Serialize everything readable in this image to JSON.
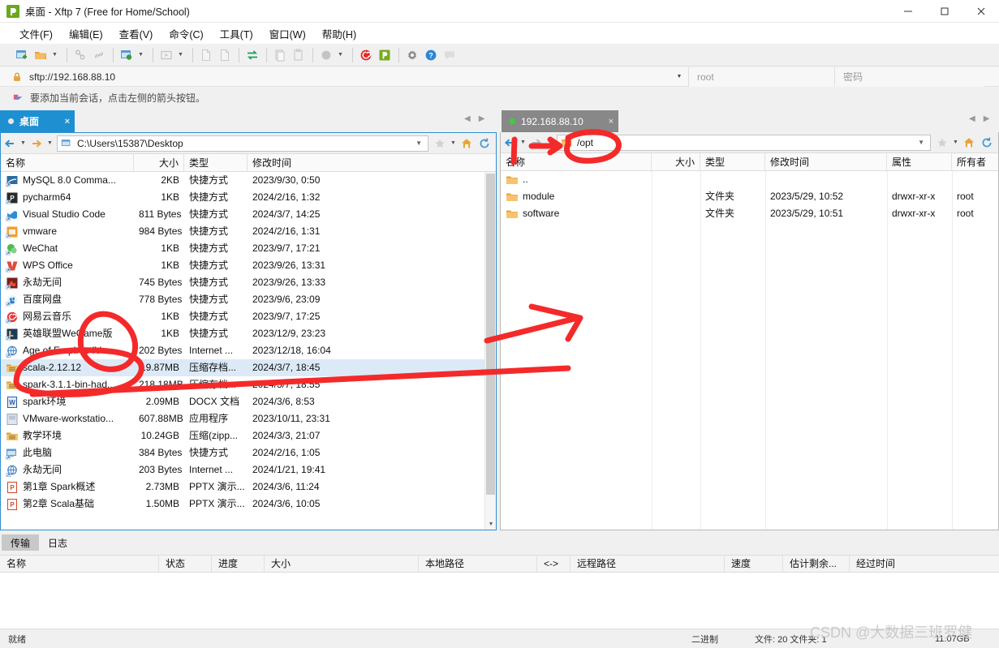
{
  "window": {
    "title": "桌面 - Xftp 7 (Free for Home/School)",
    "minimize": "—",
    "maximize": "☐",
    "close": "✕"
  },
  "menu": [
    {
      "label": "文件(F)"
    },
    {
      "label": "编辑(E)"
    },
    {
      "label": "查看(V)"
    },
    {
      "label": "命令(C)"
    },
    {
      "label": "工具(T)"
    },
    {
      "label": "窗口(W)"
    },
    {
      "label": "帮助(H)"
    }
  ],
  "toolbar": {
    "icons": [
      "new-session-icon",
      "open-folder-icon",
      "folder-dropdown-caret",
      "disconnect-icon",
      "link-icon",
      "sync-browse-icon",
      "sync-dropdown-caret",
      "transfer-start-icon",
      "transfer-dropdown-caret",
      "new-file-icon",
      "copy-file-icon",
      "swap-panes-icon",
      "copy-icon",
      "paste-icon",
      "record-icon",
      "record-dropdown-caret",
      "xshell-icon",
      "xftp-icon",
      "settings-gear-icon",
      "help-icon",
      "chat-icon"
    ]
  },
  "address": {
    "lock_icon": "lock-icon",
    "url": "sftp://192.168.88.10",
    "dropdown_caret": "chevron-down-icon",
    "username_placeholder": "root",
    "password_placeholder": "密码"
  },
  "hint": {
    "icon": "flag-icon",
    "text": "要添加当前会话，点击左侧的箭头按钮。"
  },
  "tabs": {
    "left": {
      "label": "桌面",
      "close": "×",
      "status_dot": "idle-dot-icon"
    },
    "right": {
      "label": "192.168.88.10",
      "close": "×",
      "status_dot": "connected-dot-icon"
    },
    "nav_prev": "◀",
    "nav_next": "▶"
  },
  "left_pane": {
    "path": "C:\\Users\\15387\\Desktop",
    "path_icon": "computer-folder-icon",
    "back_icon": "back-arrow-icon",
    "forward_icon": "forward-arrow-icon",
    "favorite_icon": "star-icon",
    "home_icon": "home-icon",
    "refresh_icon": "refresh-icon",
    "columns": [
      "名称",
      "大小",
      "类型",
      "修改时间"
    ],
    "rows": [
      {
        "name": "MySQL 8.0 Comma...",
        "size": "2KB",
        "type": "快捷方式",
        "mtime": "2023/9/30, 0:50",
        "icon": "shortcut-mysql-icon",
        "selected": false
      },
      {
        "name": "pycharm64",
        "size": "1KB",
        "type": "快捷方式",
        "mtime": "2024/2/16, 1:32",
        "icon": "shortcut-pycharm-icon",
        "selected": false
      },
      {
        "name": "Visual Studio Code",
        "size": "811 Bytes",
        "type": "快捷方式",
        "mtime": "2024/3/7, 14:25",
        "icon": "shortcut-vscode-icon",
        "selected": false
      },
      {
        "name": "vmware",
        "size": "984 Bytes",
        "type": "快捷方式",
        "mtime": "2024/2/16, 1:31",
        "icon": "shortcut-vmware-icon",
        "selected": false
      },
      {
        "name": "WeChat",
        "size": "1KB",
        "type": "快捷方式",
        "mtime": "2023/9/7, 17:21",
        "icon": "shortcut-wechat-icon",
        "selected": false
      },
      {
        "name": "WPS Office",
        "size": "1KB",
        "type": "快捷方式",
        "mtime": "2023/9/26, 13:31",
        "icon": "shortcut-wps-icon",
        "selected": false
      },
      {
        "name": "永劫无间",
        "size": "745 Bytes",
        "type": "快捷方式",
        "mtime": "2023/9/26, 13:33",
        "icon": "shortcut-game-icon",
        "selected": false
      },
      {
        "name": "百度网盘",
        "size": "778 Bytes",
        "type": "快捷方式",
        "mtime": "2023/9/6, 23:09",
        "icon": "shortcut-baidu-icon",
        "selected": false
      },
      {
        "name": "网易云音乐",
        "size": "1KB",
        "type": "快捷方式",
        "mtime": "2023/9/7, 17:25",
        "icon": "shortcut-netease-icon",
        "selected": false
      },
      {
        "name": "英雄联盟WeGame版",
        "size": "1KB",
        "type": "快捷方式",
        "mtime": "2023/12/9, 23:23",
        "icon": "shortcut-lol-icon",
        "selected": false
      },
      {
        "name": "Age of Empires IV",
        "size": "202 Bytes",
        "type": "Internet ...",
        "mtime": "2023/12/18, 16:04",
        "icon": "internet-shortcut-icon",
        "selected": false
      },
      {
        "name": "scala-2.12.12",
        "size": "19.87MB",
        "type": "压缩存档...",
        "mtime": "2024/3/7, 18:45",
        "icon": "archive-icon",
        "selected": true
      },
      {
        "name": "spark-3.1.1-bin-had...",
        "size": "218.18MB",
        "type": "压缩存档...",
        "mtime": "2024/3/7, 18:55",
        "icon": "archive-icon",
        "selected": false
      },
      {
        "name": "spark环境",
        "size": "2.09MB",
        "type": "DOCX 文档",
        "mtime": "2024/3/6, 8:53",
        "icon": "word-doc-icon",
        "selected": false
      },
      {
        "name": "VMware-workstatio...",
        "size": "607.88MB",
        "type": "应用程序",
        "mtime": "2023/10/11, 23:31",
        "icon": "application-icon",
        "selected": false
      },
      {
        "name": "教学环境",
        "size": "10.24GB",
        "type": "压缩(zipp...",
        "mtime": "2024/3/3, 21:07",
        "icon": "archive-icon",
        "selected": false
      },
      {
        "name": "此电脑",
        "size": "384 Bytes",
        "type": "快捷方式",
        "mtime": "2024/2/16, 1:05",
        "icon": "shortcut-computer-icon",
        "selected": false
      },
      {
        "name": "永劫无间",
        "size": "203 Bytes",
        "type": "Internet ...",
        "mtime": "2024/1/21, 19:41",
        "icon": "internet-shortcut-icon",
        "selected": false
      },
      {
        "name": "第1章 Spark概述",
        "size": "2.73MB",
        "type": "PPTX 演示...",
        "mtime": "2024/3/6, 11:24",
        "icon": "powerpoint-icon",
        "selected": false
      },
      {
        "name": "第2章 Scala基础",
        "size": "1.50MB",
        "type": "PPTX 演示...",
        "mtime": "2024/3/6, 10:05",
        "icon": "powerpoint-icon",
        "selected": false
      }
    ]
  },
  "right_pane": {
    "path": "/opt",
    "path_icon": "folder-icon",
    "back_icon": "back-arrow-icon",
    "forward_icon": "forward-arrow-icon",
    "favorite_icon": "star-icon",
    "home_icon": "home-icon",
    "refresh_icon": "refresh-icon",
    "columns": [
      "名称",
      "大小",
      "类型",
      "修改时间",
      "属性",
      "所有者"
    ],
    "rows": [
      {
        "name": "..",
        "size": "",
        "type": "",
        "mtime": "",
        "attr": "",
        "owner": "",
        "icon": "folder-up-icon"
      },
      {
        "name": "module",
        "size": "",
        "type": "文件夹",
        "mtime": "2023/5/29, 10:52",
        "attr": "drwxr-xr-x",
        "owner": "root",
        "icon": "folder-icon"
      },
      {
        "name": "software",
        "size": "",
        "type": "文件夹",
        "mtime": "2023/5/29, 10:51",
        "attr": "drwxr-xr-x",
        "owner": "root",
        "icon": "folder-icon"
      }
    ]
  },
  "transfer": {
    "tabs": [
      {
        "label": "传输",
        "active": true
      },
      {
        "label": "日志",
        "active": false
      }
    ],
    "columns": [
      "名称",
      "状态",
      "进度",
      "大小",
      "本地路径",
      "<->",
      "远程路径",
      "速度",
      "估计剩余...",
      "经过时间"
    ],
    "rows": []
  },
  "status": {
    "ready": "就绪",
    "mode": "二进制",
    "counts": "文件: 20 文件夹: 1",
    "total_size": "11.07GB"
  },
  "watermark": "CSDN @大数据三班罗健"
}
